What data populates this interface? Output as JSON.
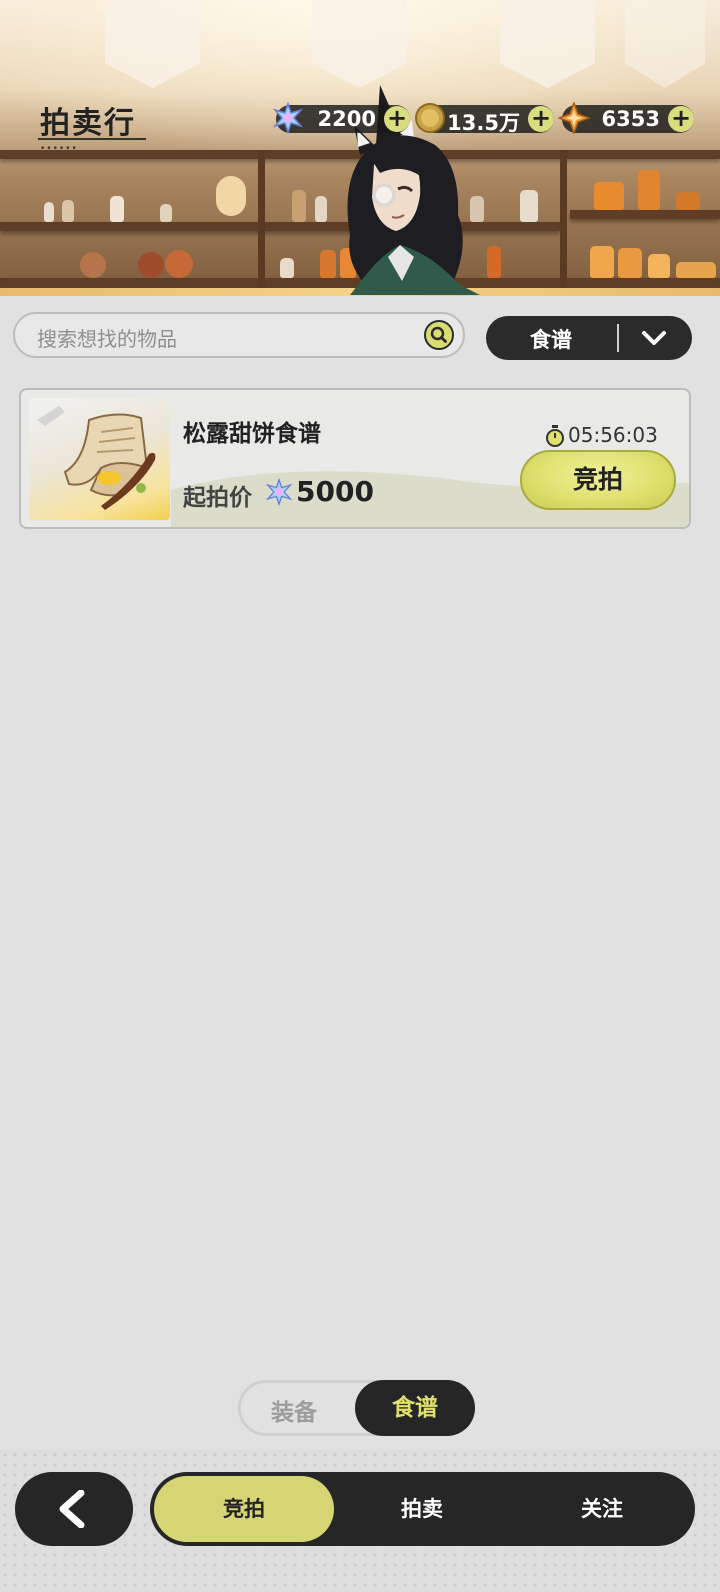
{
  "header": {
    "title": "拍卖行",
    "currencies": [
      {
        "icon": "crystal-icon",
        "value": "2200"
      },
      {
        "icon": "gold-coin-icon",
        "value": "13.5万"
      },
      {
        "icon": "star-gem-icon",
        "value": "6353"
      }
    ],
    "plus_label": "+"
  },
  "search": {
    "placeholder": "搜索想找的物品"
  },
  "filter": {
    "selected": "食谱"
  },
  "listing": [
    {
      "name": "松露甜饼食谱",
      "price_label": "起拍价",
      "price": "5000",
      "timer": "05:56:03",
      "bid_label": "竞拍"
    }
  ],
  "category_toggle": {
    "inactive": "装备",
    "active": "食谱"
  },
  "bottom_nav": {
    "tabs": [
      "竞拍",
      "拍卖",
      "关注"
    ],
    "active_index": 0
  },
  "colors": {
    "accent": "#d8da72",
    "dark": "#262626",
    "background": "#e1e1e1"
  }
}
